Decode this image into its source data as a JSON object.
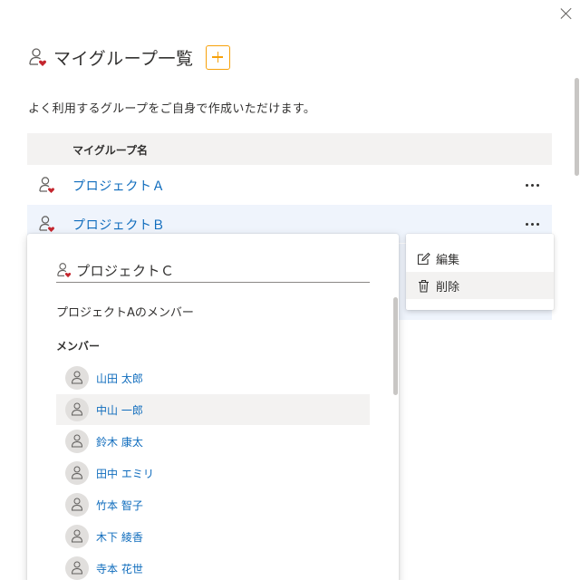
{
  "header": {
    "title": "マイグループ一覧",
    "subtitle": "よく利用するグループをご自身で作成いただけます。"
  },
  "table": {
    "column_name": "マイグループ名",
    "rows": [
      {
        "name": "プロジェクトＡ"
      },
      {
        "name": "プロジェクトＢ"
      }
    ]
  },
  "context_menu": {
    "edit": "編集",
    "delete": "削除"
  },
  "group_card": {
    "name_value": "プロジェクトＣ",
    "description": "プロジェクトAのメンバー",
    "members_label": "メンバー",
    "members": [
      {
        "name": "山田 太郎"
      },
      {
        "name": "中山 一郎"
      },
      {
        "name": "鈴木 康太"
      },
      {
        "name": "田中 エミリ"
      },
      {
        "name": "竹本 智子"
      },
      {
        "name": "木下 綾香"
      },
      {
        "name": "寺本 花世"
      }
    ]
  },
  "colors": {
    "accent_orange": "#f7a10a",
    "link_blue": "#0f6cbd",
    "heart_red": "#c4262e"
  },
  "icons": {
    "group": "group-heart-icon",
    "person": "person-icon",
    "edit": "edit-icon",
    "delete": "trash-icon",
    "more": "more-horizontal-icon",
    "close": "close-icon",
    "add": "add-icon"
  }
}
